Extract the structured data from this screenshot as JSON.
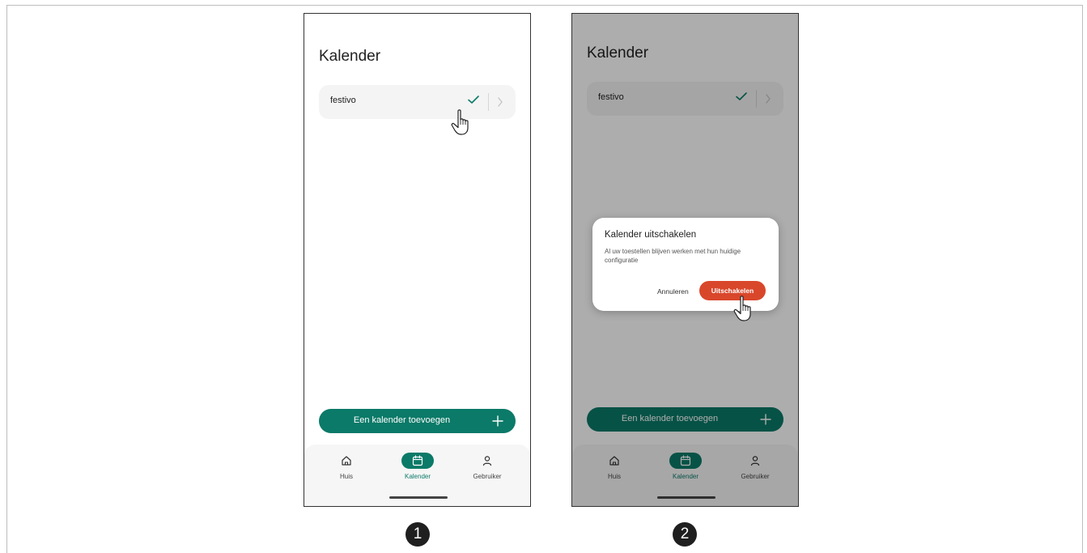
{
  "screens": [
    {
      "step": "1",
      "title": "Kalender",
      "calendar_item": {
        "name": "festivo"
      },
      "add_button_label": "Een kalender toevoegen",
      "nav": [
        {
          "label": "Huis",
          "icon": "home-icon",
          "active": false
        },
        {
          "label": "Kalender",
          "icon": "calendar-icon",
          "active": true
        },
        {
          "label": "Gebruiker",
          "icon": "user-icon",
          "active": false
        }
      ]
    },
    {
      "step": "2",
      "title": "Kalender",
      "calendar_item": {
        "name": "festivo"
      },
      "add_button_label": "Een kalender toevoegen",
      "nav": [
        {
          "label": "Huis",
          "icon": "home-icon",
          "active": false
        },
        {
          "label": "Kalender",
          "icon": "calendar-icon",
          "active": true
        },
        {
          "label": "Gebruiker",
          "icon": "user-icon",
          "active": false
        }
      ],
      "dialog": {
        "title": "Kalender uitschakelen",
        "message": "Al uw toestellen blijven werken met hun huidige configuratie",
        "cancel_label": "Annuleren",
        "confirm_label": "Uitschakelen"
      }
    }
  ],
  "colors": {
    "accent": "#0b7a68",
    "danger": "#d9472b",
    "overlay": "rgba(0,0,0,0.32)"
  }
}
